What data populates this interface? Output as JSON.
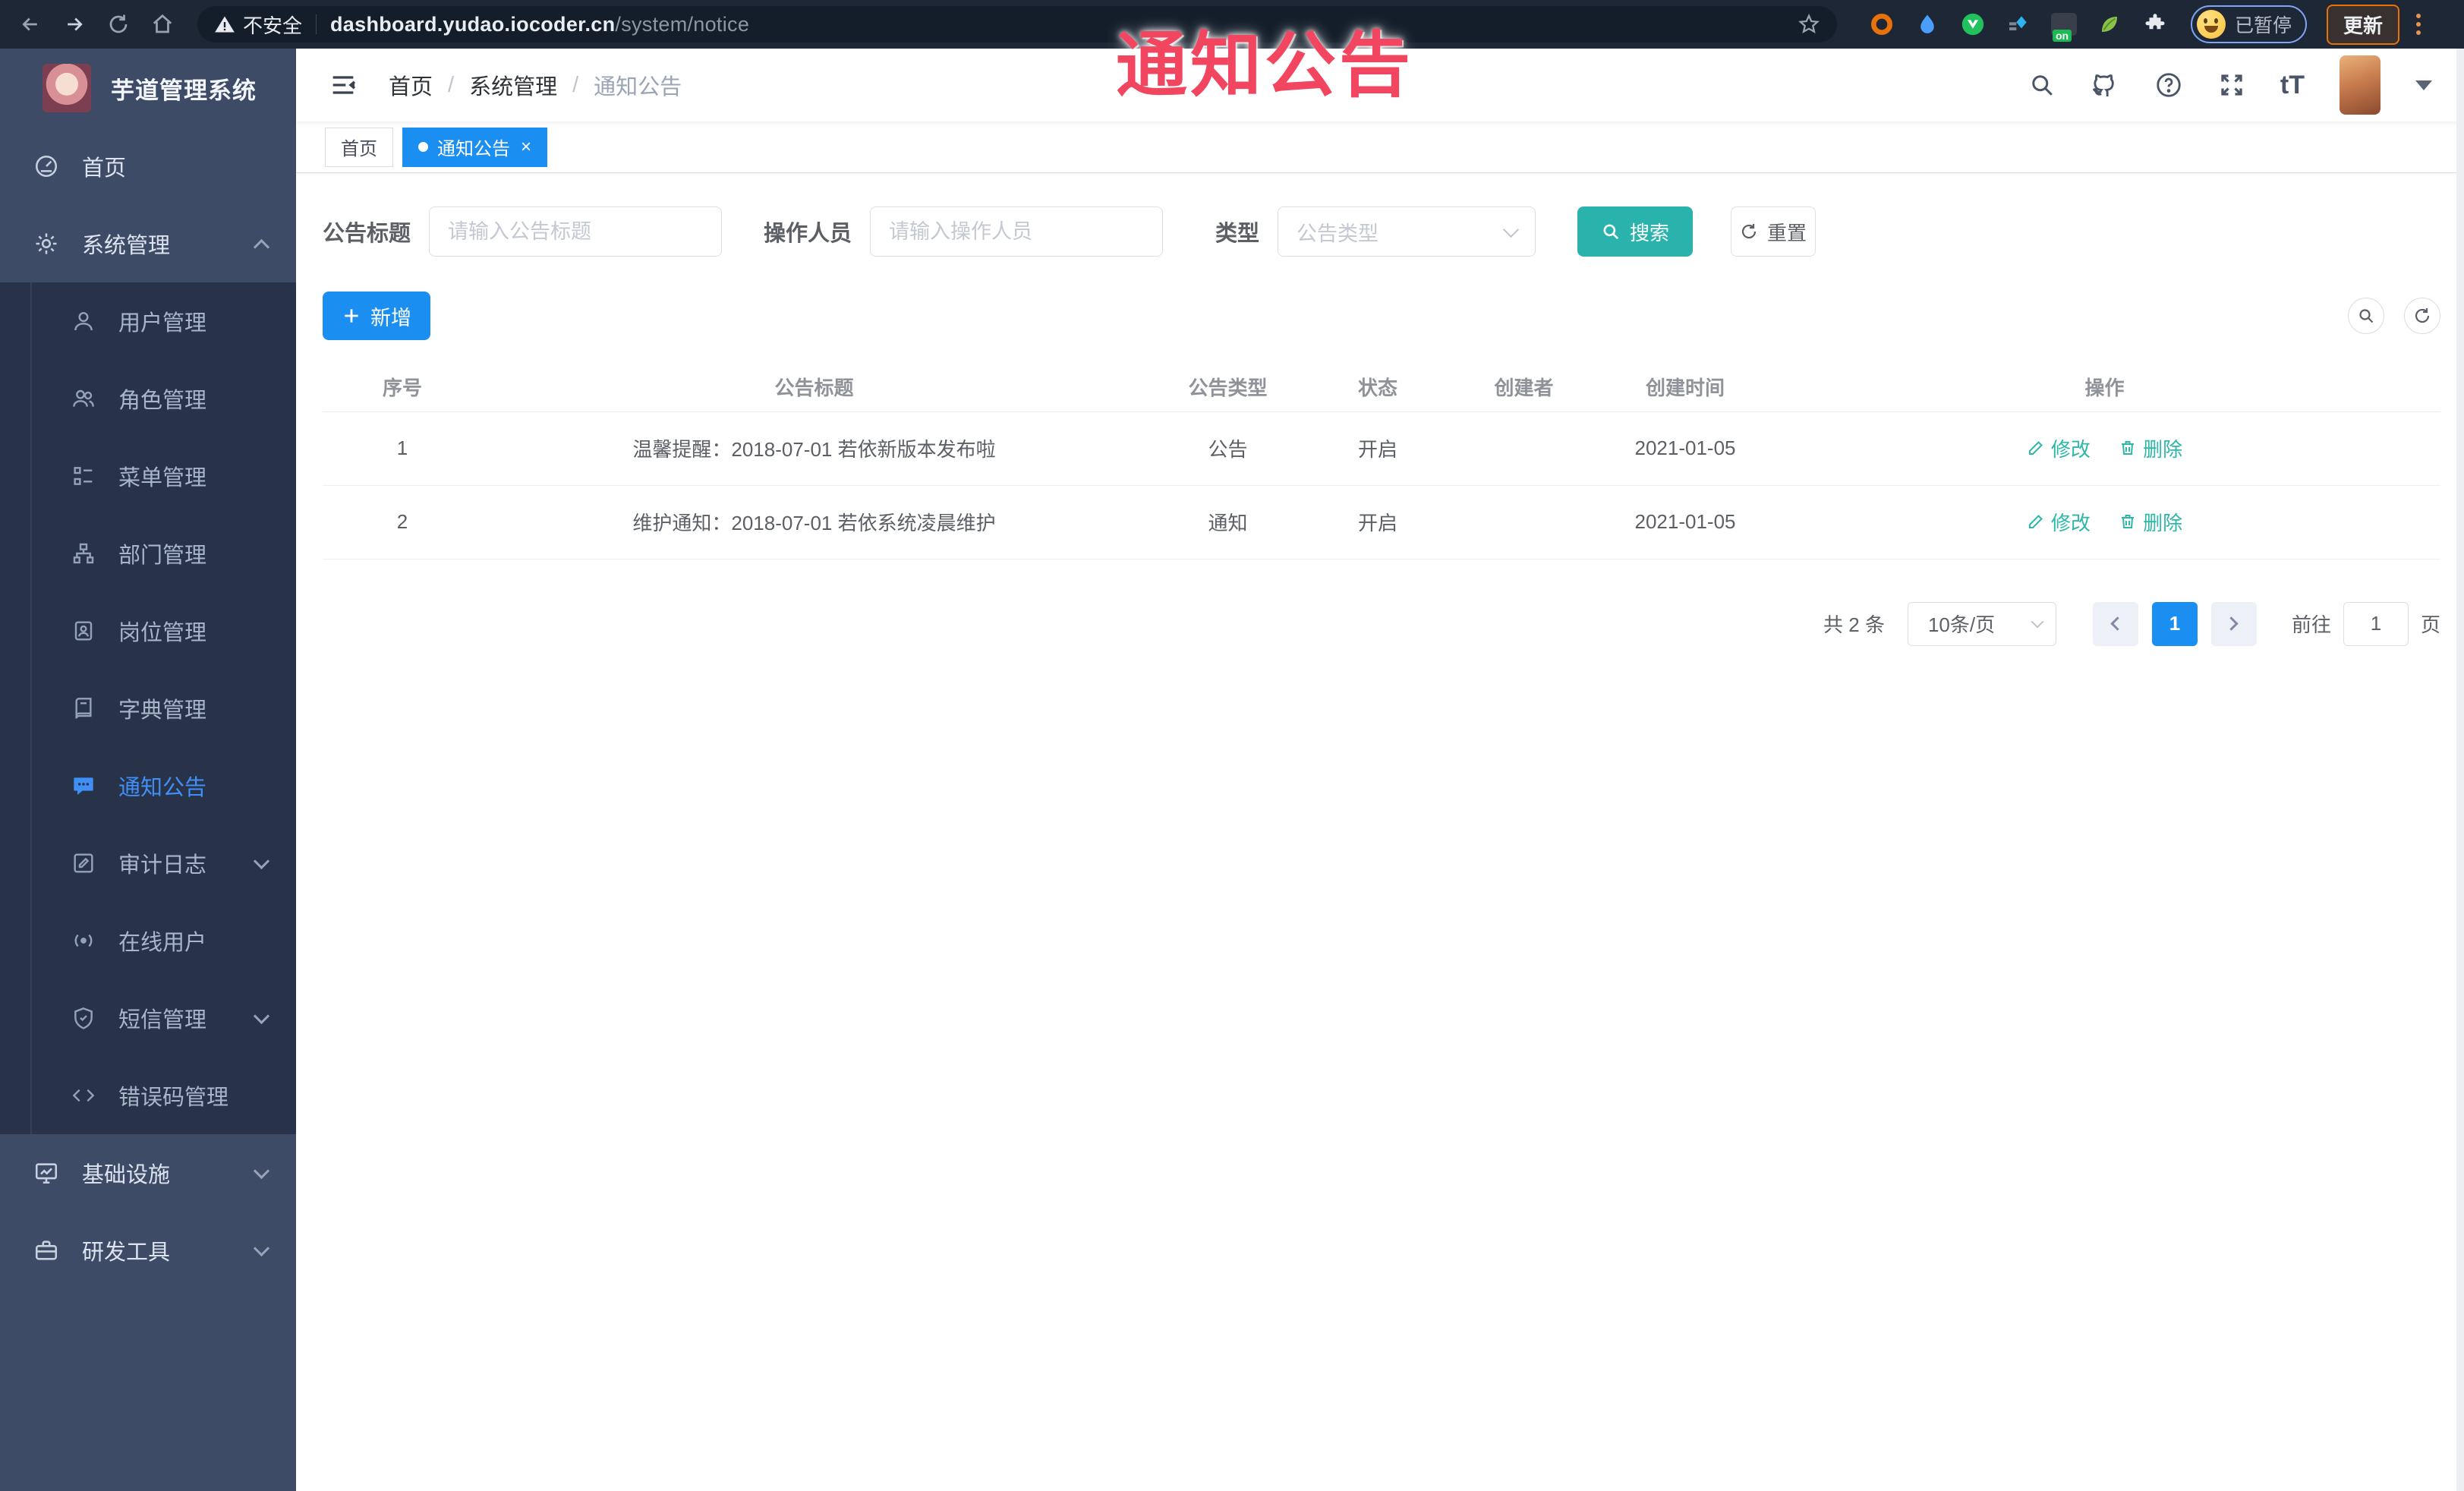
{
  "browser": {
    "security_warning": "不安全",
    "url_host": "dashboard.yudao.iocoder.cn",
    "url_path": "/system/notice",
    "ext_on_badge": "on",
    "paused_label": "已暂停",
    "update_label": "更新"
  },
  "overlay": {
    "title": "通知公告"
  },
  "sidebar": {
    "logo_title": "芋道管理系统",
    "home_label": "首页",
    "system_label": "系统管理",
    "submenu": [
      "用户管理",
      "角色管理",
      "菜单管理",
      "部门管理",
      "岗位管理",
      "字典管理",
      "通知公告",
      "审计日志",
      "在线用户",
      "短信管理",
      "错误码管理"
    ],
    "infra_label": "基础设施",
    "devtools_label": "研发工具"
  },
  "breadcrumb": {
    "items": [
      "首页",
      "系统管理",
      "通知公告"
    ]
  },
  "tabs": {
    "home": "首页",
    "active": "通知公告"
  },
  "filters": {
    "title_label": "公告标题",
    "title_placeholder": "请输入公告标题",
    "operator_label": "操作人员",
    "operator_placeholder": "请输入操作人员",
    "type_label": "类型",
    "type_placeholder": "公告类型",
    "search_label": "搜索",
    "reset_label": "重置"
  },
  "toolbar": {
    "add_label": "新增"
  },
  "table": {
    "columns": [
      "序号",
      "公告标题",
      "公告类型",
      "状态",
      "创建者",
      "创建时间",
      "操作"
    ],
    "rows": [
      {
        "index": "1",
        "title": "温馨提醒：2018-07-01 若依新版本发布啦",
        "type": "公告",
        "status": "开启",
        "creator": "",
        "created": "2021-01-05"
      },
      {
        "index": "2",
        "title": "维护通知：2018-07-01 若依系统凌晨维护",
        "type": "通知",
        "status": "开启",
        "creator": "",
        "created": "2021-01-05"
      }
    ],
    "actions": {
      "edit": "修改",
      "delete": "删除"
    }
  },
  "pagination": {
    "total": "共 2 条",
    "page_size": "10条/页",
    "current_page": "1",
    "goto_label": "前往",
    "goto_value": "1",
    "unit_label": "页"
  },
  "colors": {
    "primary_blue": "#1b8ef2",
    "search_teal": "#2ab3ad",
    "action_link_teal": "#2db7a8",
    "annotation_red": "#f2455f",
    "sidebar_bg": "#3d4b66",
    "submenu_bg": "#283349",
    "chrome_bg": "#1d2736"
  }
}
